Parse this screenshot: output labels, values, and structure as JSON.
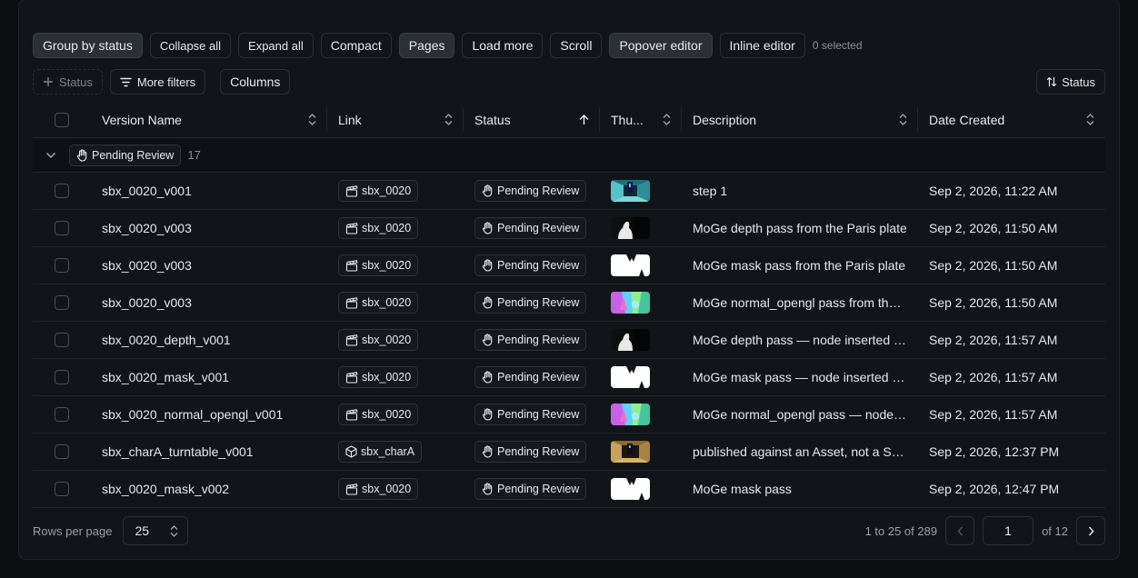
{
  "toolbar": {
    "buttons": [
      {
        "label": "Group by status",
        "active": true
      },
      {
        "label": "Collapse all",
        "active": false
      },
      {
        "label": "Expand all",
        "active": false
      },
      {
        "label": "Compact",
        "active": false
      },
      {
        "label": "Pages",
        "active": true
      },
      {
        "label": "Load more",
        "active": false
      },
      {
        "label": "Scroll",
        "active": false
      },
      {
        "label": "Popover editor",
        "active": true
      },
      {
        "label": "Inline editor",
        "active": false
      }
    ],
    "selected_text": "0 selected"
  },
  "filters": {
    "status_filter": "Status",
    "more_filters": "More filters",
    "columns": "Columns",
    "sort_label": "Status"
  },
  "columns": [
    "Version Name",
    "Link",
    "Status",
    "Thu...",
    "Description",
    "Date Created"
  ],
  "group": {
    "label": "Pending Review",
    "count": "17"
  },
  "rows": [
    {
      "name": "sbx_0020_v001",
      "link": "sbx_0020",
      "link_type": "shot",
      "status": "Pending Review",
      "thumb": "corridor",
      "description": "step 1",
      "date": "Sep 2, 2026, 11:22 AM"
    },
    {
      "name": "sbx_0020_v003",
      "link": "sbx_0020",
      "link_type": "shot",
      "status": "Pending Review",
      "thumb": "depth",
      "description": "MoGe depth pass from the Paris plate",
      "date": "Sep 2, 2026, 11:50 AM"
    },
    {
      "name": "sbx_0020_v003",
      "link": "sbx_0020",
      "link_type": "shot",
      "status": "Pending Review",
      "thumb": "mask",
      "description": "MoGe mask pass from the Paris plate",
      "date": "Sep 2, 2026, 11:50 AM"
    },
    {
      "name": "sbx_0020_v003",
      "link": "sbx_0020",
      "link_type": "shot",
      "status": "Pending Review",
      "thumb": "normal",
      "description": "MoGe normal_opengl pass from the Paris plate",
      "date": "Sep 2, 2026, 11:50 AM"
    },
    {
      "name": "sbx_0020_depth_v001",
      "link": "sbx_0020",
      "link_type": "shot",
      "status": "Pending Review",
      "thumb": "depth",
      "description": "MoGe depth pass — node inserted into graph",
      "date": "Sep 2, 2026, 11:57 AM"
    },
    {
      "name": "sbx_0020_mask_v001",
      "link": "sbx_0020",
      "link_type": "shot",
      "status": "Pending Review",
      "thumb": "mask",
      "description": "MoGe mask pass — node inserted into graph",
      "date": "Sep 2, 2026, 11:57 AM"
    },
    {
      "name": "sbx_0020_normal_opengl_v001",
      "link": "sbx_0020",
      "link_type": "shot",
      "status": "Pending Review",
      "thumb": "normal",
      "description": "MoGe normal_opengl pass — node inserted into graph",
      "date": "Sep 2, 2026, 11:57 AM"
    },
    {
      "name": "sbx_charA_turntable_v001",
      "link": "sbx_charA",
      "link_type": "asset",
      "status": "Pending Review",
      "thumb": "gold",
      "description": "published against an Asset, not a Shot",
      "date": "Sep 2, 2026, 12:37 PM"
    },
    {
      "name": "sbx_0020_mask_v002",
      "link": "sbx_0020",
      "link_type": "shot",
      "status": "Pending Review",
      "thumb": "mask",
      "description": "MoGe mask pass",
      "date": "Sep 2, 2026, 12:47 PM"
    }
  ],
  "footer": {
    "rows_per_page_label": "Rows per page",
    "rows_per_page": "25",
    "range": "1 to 25 of 289",
    "page": "1",
    "of_pages": "of 12"
  },
  "icons": {
    "status": "hand-icon",
    "shot_link": "clapperboard-icon",
    "asset_link": "cube-icon"
  }
}
